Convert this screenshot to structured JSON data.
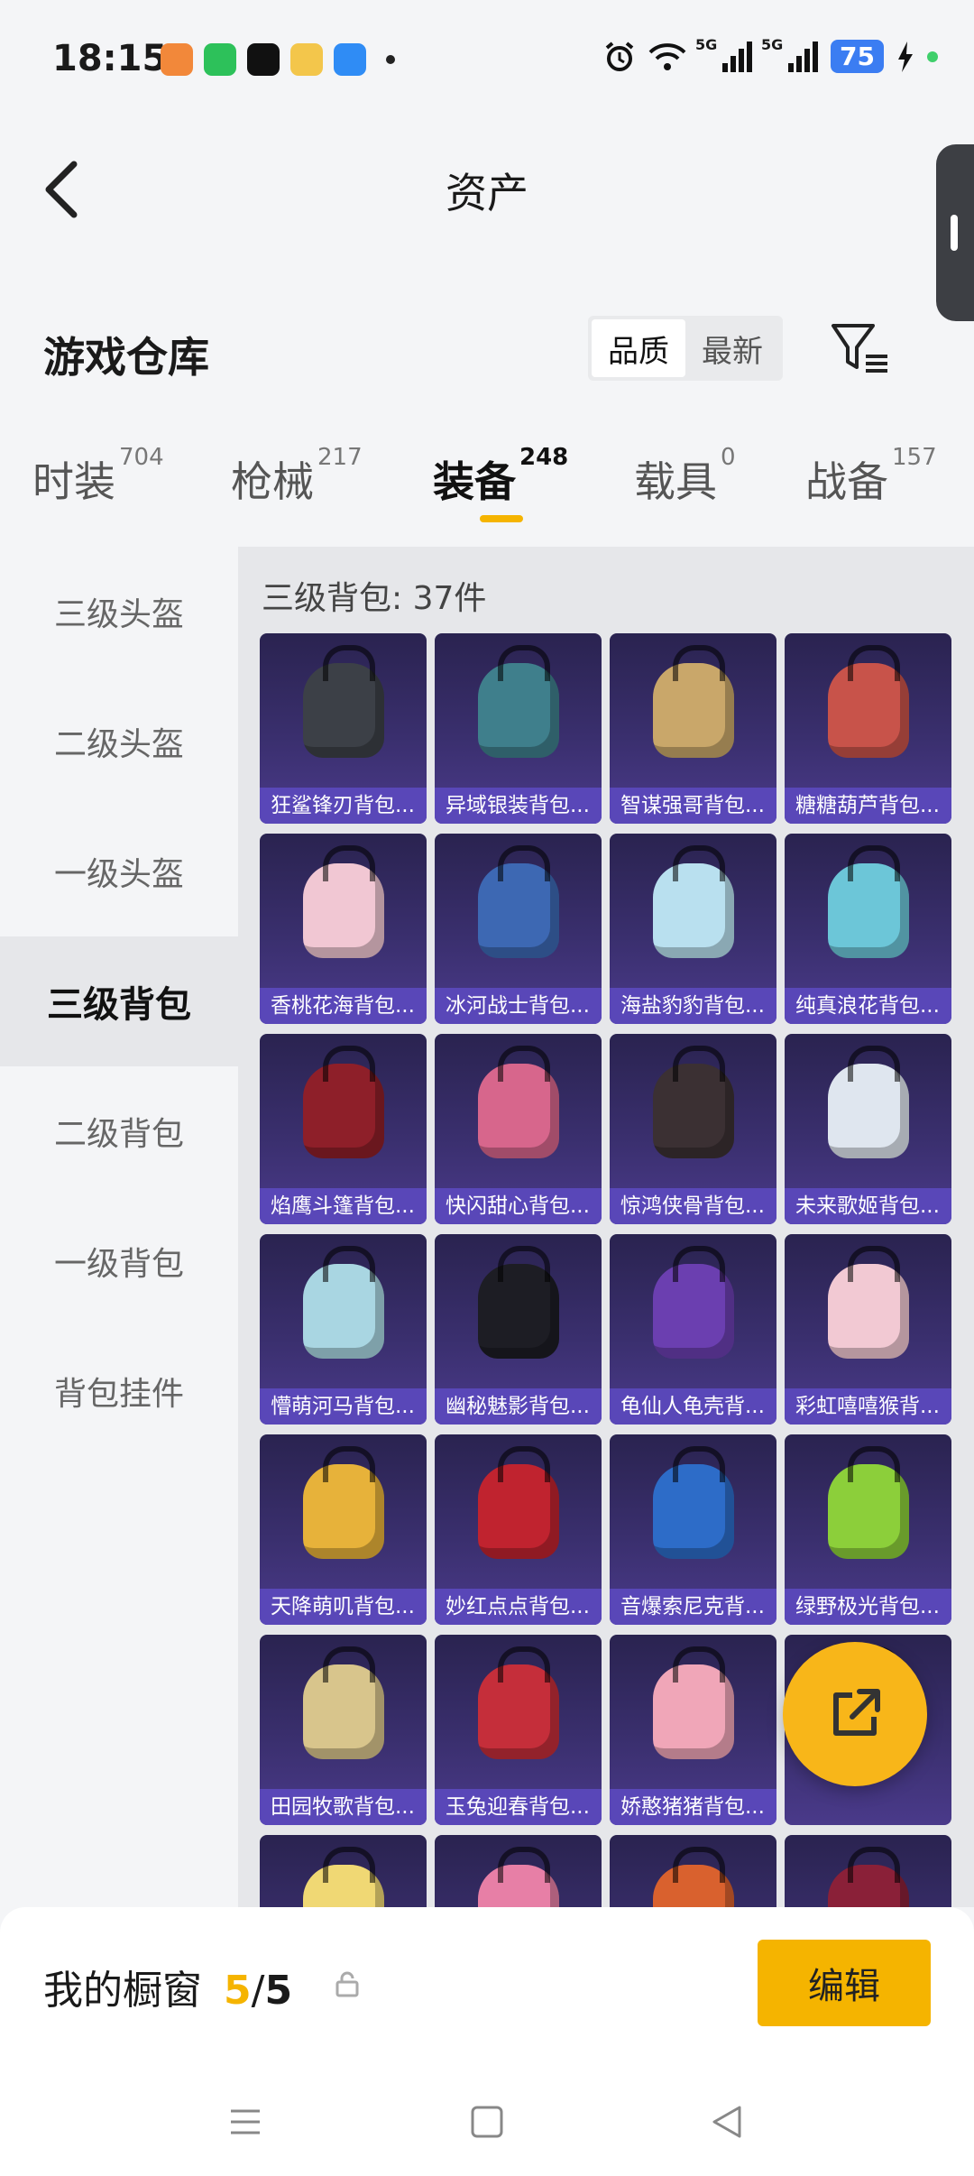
{
  "status_bar": {
    "time": "18:15",
    "battery": "75",
    "signal1": "5G",
    "signal2": "5G"
  },
  "header": {
    "title": "资产"
  },
  "warehouse": {
    "title": "游戏仓库",
    "sort_options": [
      "品质",
      "最新"
    ],
    "active_sort": "品质"
  },
  "tabs": [
    {
      "label": "时装",
      "count": "704"
    },
    {
      "label": "枪械",
      "count": "217"
    },
    {
      "label": "装备",
      "count": "248",
      "active": true
    },
    {
      "label": "载具",
      "count": "0"
    },
    {
      "label": "战备",
      "count": "157"
    }
  ],
  "sidebar": {
    "items": [
      "三级头盔",
      "二级头盔",
      "一级头盔",
      "三级背包",
      "二级背包",
      "一级背包",
      "背包挂件"
    ],
    "active": "三级背包"
  },
  "content": {
    "count_text": "三级背包: 37件",
    "items": [
      {
        "name": "狂鲨锋刃背包...",
        "color": "#3c4047"
      },
      {
        "name": "异域银装背包...",
        "color": "#3f7f8c"
      },
      {
        "name": "智谋强哥背包...",
        "color": "#c9a76a"
      },
      {
        "name": "糖糖葫芦背包...",
        "color": "#c8534a"
      },
      {
        "name": "香桃花海背包...",
        "color": "#f1c7d3"
      },
      {
        "name": "冰河战士背包...",
        "color": "#3d68b3"
      },
      {
        "name": "海盐豹豹背包...",
        "color": "#b9e0ef"
      },
      {
        "name": "纯真浪花背包...",
        "color": "#6cc6d8"
      },
      {
        "name": "焰鹰斗篷背包...",
        "color": "#8e1f29"
      },
      {
        "name": "快闪甜心背包...",
        "color": "#d7668c"
      },
      {
        "name": "惊鸿侠骨背包...",
        "color": "#3b3033"
      },
      {
        "name": "未来歌姬背包...",
        "color": "#dfe6ef"
      },
      {
        "name": "懵萌河马背包...",
        "color": "#a9d6e2"
      },
      {
        "name": "幽秘魅影背包...",
        "color": "#1d1d24"
      },
      {
        "name": "龟仙人龟壳背...",
        "color": "#6b3fb0"
      },
      {
        "name": "彩虹嘻嘻猴背...",
        "color": "#f2c9d3"
      },
      {
        "name": "天降萌叽背包...",
        "color": "#e7b23a"
      },
      {
        "name": "妙红点点背包...",
        "color": "#c0232f"
      },
      {
        "name": "音爆索尼克背...",
        "color": "#2d6cc8"
      },
      {
        "name": "绿野极光背包...",
        "color": "#8ccf3a"
      },
      {
        "name": "田园牧歌背包...",
        "color": "#d8c58c"
      },
      {
        "name": "玉兔迎春背包...",
        "color": "#c52e3a"
      },
      {
        "name": "娇憨猪猪背包...",
        "color": "#f0a6b8"
      },
      {
        "name": "",
        "color": "#7a3c9a"
      },
      {
        "name": "",
        "color": "#f0d874"
      },
      {
        "name": "",
        "color": "#e77fa6"
      },
      {
        "name": "",
        "color": "#d9612e"
      },
      {
        "name": "",
        "color": "#8a2038"
      }
    ]
  },
  "share_button": {
    "icon": "share-icon"
  },
  "bottom_bar": {
    "label": "我的橱窗",
    "current": "5",
    "separator": "/",
    "total": "5",
    "edit_label": "编辑"
  },
  "colors": {
    "accent": "#f5b400",
    "card_label": "#5947b8"
  }
}
